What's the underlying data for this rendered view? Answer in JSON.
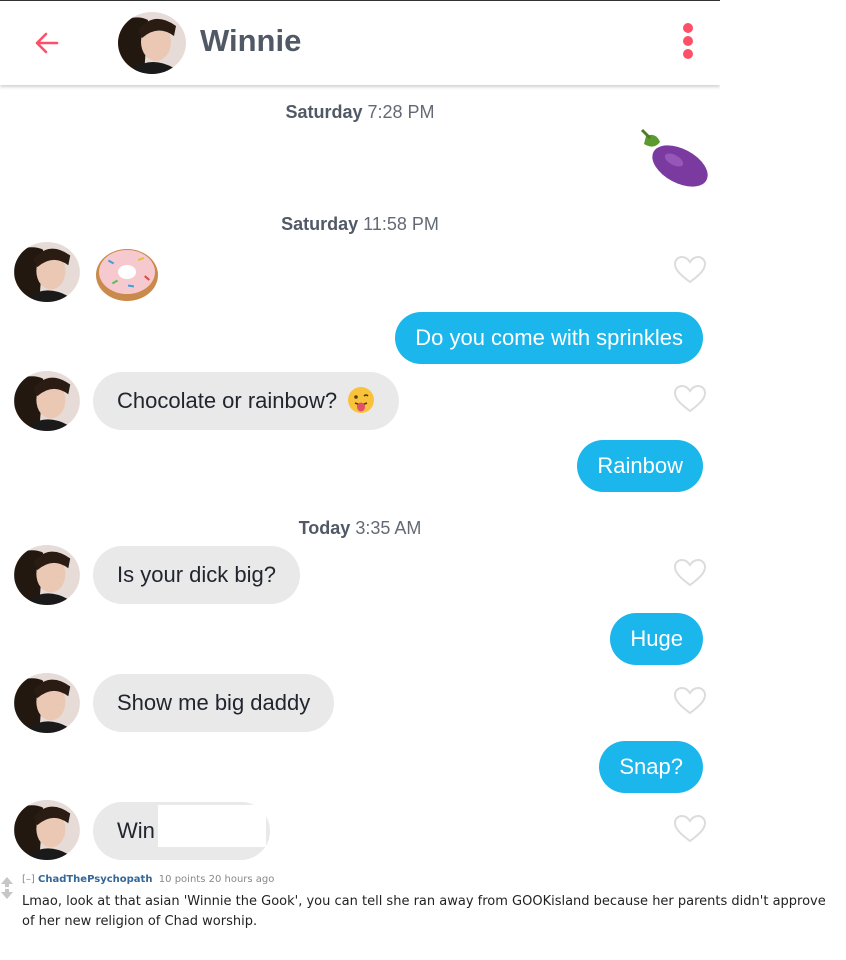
{
  "header": {
    "title": "Winnie",
    "back_icon": "back-arrow-icon",
    "menu_icon": "more-vertical-icon",
    "accent": "#fd5068"
  },
  "timestamps": [
    {
      "day": "Saturday",
      "time": "7:28 PM"
    },
    {
      "day": "Saturday",
      "time": "11:58 PM"
    },
    {
      "day": "Today",
      "time": "3:35 AM"
    }
  ],
  "messages": {
    "eggplant_emoji": "🍆",
    "donut_emoji": "🍩",
    "sprinkles": "Do you come with sprinkles",
    "chocolate": "Chocolate or rainbow?",
    "tongue_emoji": "😛",
    "rainbow": "Rainbow",
    "big": "Is your dick big?",
    "huge": "Huge",
    "show": "Show me big daddy",
    "snap": "Snap?",
    "win": "Win"
  },
  "colors": {
    "outgoing": "#1bb7ec",
    "incoming": "#e9e9ea"
  },
  "comment": {
    "collapse": "[–]",
    "author": "ChadThePsychopath",
    "points": "10 points",
    "age": "20 hours ago",
    "text": "Lmao, look at that asian 'Winnie the Gook', you can tell she ran away from GOOKisland because her parents didn't approve of her new religion of Chad worship."
  }
}
